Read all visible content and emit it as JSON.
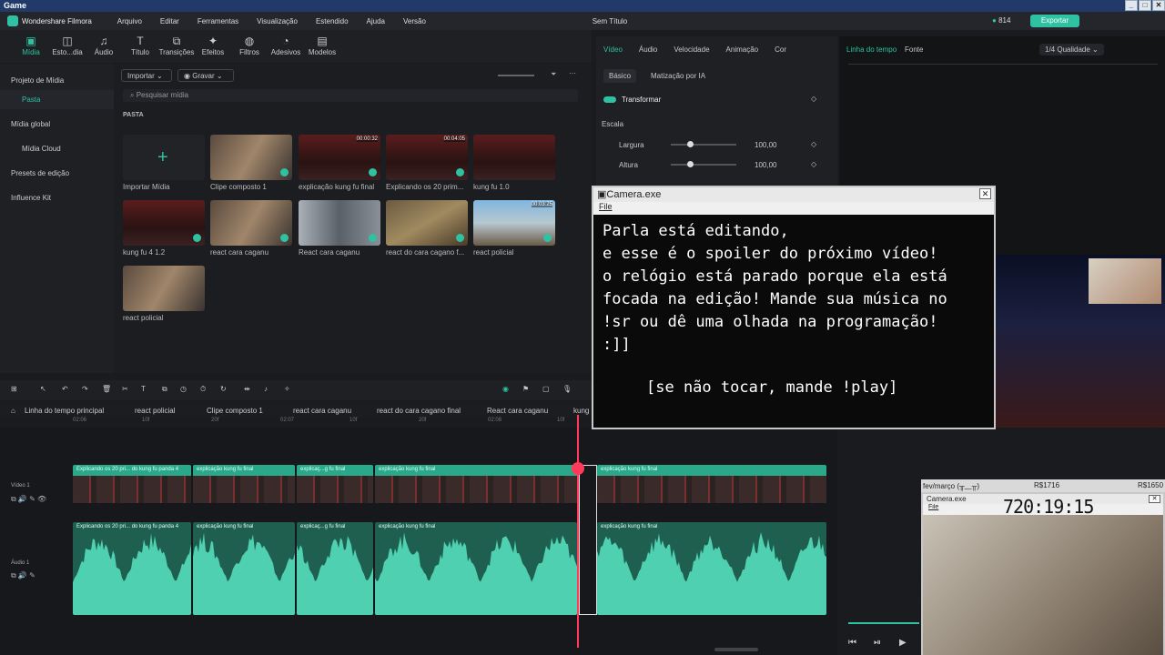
{
  "os_title": "Game",
  "app": {
    "name": "Wondershare Filmora",
    "project_title": "Sem Título",
    "credits": "814",
    "export_label": "Exportar"
  },
  "menu": [
    "Arquivo",
    "Editar",
    "Ferramentas",
    "Visualização",
    "Estendido",
    "Ajuda",
    "Versão"
  ],
  "toolbar": [
    {
      "label": "Mídia",
      "icon": "media-icon"
    },
    {
      "label": "Esto...dia",
      "icon": "stock-icon"
    },
    {
      "label": "Áudio",
      "icon": "audio-icon"
    },
    {
      "label": "Título",
      "icon": "title-icon"
    },
    {
      "label": "Transições",
      "icon": "transitions-icon"
    },
    {
      "label": "Efeitos",
      "icon": "effects-icon"
    },
    {
      "label": "Filtros",
      "icon": "filters-icon"
    },
    {
      "label": "Adesivos",
      "icon": "stickers-icon"
    },
    {
      "label": "Modelos",
      "icon": "templates-icon"
    }
  ],
  "sidebar": [
    "Projeto de Mídia",
    "Pasta",
    "Mídia global",
    "Mídia Cloud",
    "Presets de edição",
    "Influence Kit"
  ],
  "mediabin": {
    "import_label": "Importar",
    "record_label": "Gravar",
    "search_placeholder": "Pesquisar mídia",
    "folder_label": "PASTA",
    "items": [
      {
        "label": "Importar Mídia",
        "duration": ""
      },
      {
        "label": "Clipe composto 1",
        "duration": ""
      },
      {
        "label": "explicação kung fu final",
        "duration": "00:00:32"
      },
      {
        "label": "Explicando os 20 prim...",
        "duration": "00:04:05"
      },
      {
        "label": "kung fu 1.0",
        "duration": ""
      },
      {
        "label": "kung fu 4 1.2",
        "duration": ""
      },
      {
        "label": "react cara caganu",
        "duration": ""
      },
      {
        "label": "React cara caganu",
        "duration": ""
      },
      {
        "label": "react do cara cagano f...",
        "duration": ""
      },
      {
        "label": "react policial",
        "duration": "00:03:25"
      },
      {
        "label": "react policial",
        "duration": ""
      }
    ]
  },
  "props": {
    "tabs": [
      "Vídeo",
      "Áudio",
      "Velocidade",
      "Animação",
      "Cor"
    ],
    "subtabs": [
      "Básico",
      "Matização por IA"
    ],
    "transform_label": "Transformar",
    "scale_label": "Escala",
    "width_label": "Largura",
    "width_value": "100,00",
    "height_label": "Altura",
    "height_value": "100,00"
  },
  "preview": {
    "tab_main": "Linha do tempo",
    "tab_source": "Fonte",
    "quality": "1/4 Qualidade"
  },
  "camera1": {
    "title": "Camera.exe",
    "menu": "File",
    "message": "Parla está editando,\ne esse é o spoiler do próximo vídeo!\no relógio está parado porque ela está\nfocada na edição! Mande sua música no\n!sr ou dê uma olhada na programação!\n:]]",
    "play_hint": "[se não tocar, mande !play]"
  },
  "timeline": {
    "main_label": "Linha do tempo principal",
    "breadcrumbs": [
      "react policial",
      "Clipe composto 1",
      "react cara caganu",
      "react do cara cagano final",
      "React cara caganu",
      "kung"
    ],
    "ruler": [
      "02:06",
      "10f",
      "20f",
      "02:07",
      "10f",
      "20f",
      "02:08",
      "10f"
    ],
    "video_track": "Vídeo 1",
    "audio_track": "Áudio 1",
    "video_clips": [
      "Explicando os 20 pri... do kung fu panda 4",
      "explicação kung fu final",
      "explicaç...g fu final",
      "explicação kung fu final",
      "explicação kung fu final"
    ],
    "audio_clips": [
      "Explicando os 20 pri... do kung fu panda 4",
      "explicação kung fu final",
      "explicaç...g fu final",
      "explicação kung fu final",
      "explicação kung fu final"
    ]
  },
  "clock_window": {
    "header": "fev/março (╥﹏╥)",
    "amount1": "R$1716",
    "amount2": "R$1650",
    "title": "Camera.exe",
    "menu": "File",
    "time": "720:19:15"
  }
}
